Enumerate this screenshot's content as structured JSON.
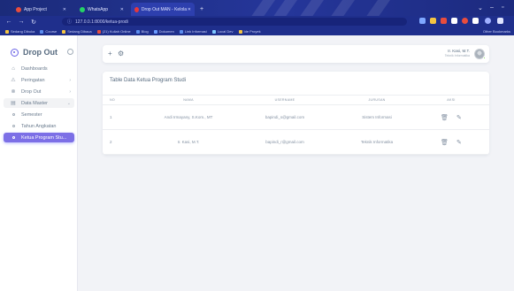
{
  "browser": {
    "tabs": [
      {
        "label": "App Project",
        "fav_color": "#e94d3d"
      },
      {
        "label": "WhatsApp",
        "fav_color": "#25d366"
      },
      {
        "label": "Drop Out MAN - Kelola Prodi",
        "fav_color": "#e6383c"
      }
    ],
    "url": "127.0.0.1:8000/ketua-prodi",
    "bookmarks": [
      {
        "label": "Sedang Dibuka",
        "color": "#f4c542"
      },
      {
        "label": "Course",
        "color": "#5b8def"
      },
      {
        "label": "Sedang Dibaca",
        "color": "#f4c542"
      },
      {
        "label": "(21) Kuliah Online",
        "color": "#e94d3d"
      },
      {
        "label": "Blog",
        "color": "#5b8def"
      },
      {
        "label": "Dokumen",
        "color": "#6a9bff"
      },
      {
        "label": "Link Informasi",
        "color": "#5b8def"
      },
      {
        "label": "Local Dev",
        "color": "#7ec8ff"
      },
      {
        "label": "Ide Proyek",
        "color": "#f4c542"
      }
    ],
    "bookmarks_right": "Other Bookmarks"
  },
  "sidebar": {
    "brand": "Drop Out",
    "items": [
      {
        "label": "Dashboards",
        "icon": "home-icon",
        "glyph": "⌂",
        "chevron": false
      },
      {
        "label": "Peringatan",
        "icon": "warning-icon",
        "glyph": "⚠",
        "chevron": true
      },
      {
        "label": "Drop Out",
        "icon": "dropout-icon",
        "glyph": "⊗",
        "chevron": true
      },
      {
        "label": "Data Master",
        "icon": "database-icon",
        "glyph": "▤",
        "chevron": true
      }
    ],
    "sub_items": [
      {
        "label": "Semester"
      },
      {
        "label": "Tahun Angkatan"
      },
      {
        "label": "Ketua Program Stu..."
      }
    ]
  },
  "topbar": {
    "plus": "+",
    "gear": "⚙",
    "user_name": "Ir. Kasi, M.T.",
    "user_role": "Teknik Informatika"
  },
  "table": {
    "title": "Table Data Ketua Program Studi",
    "headers": [
      "NO",
      "NAMA",
      "USERNAME",
      "JURUSAN",
      "AKSI"
    ],
    "rows": [
      {
        "no": "1",
        "nama": "Andi Irmayany, S.Kom., MT",
        "username": "bapindi_s@gmail.com",
        "jurusan": "Sistem Informasi"
      },
      {
        "no": "2",
        "nama": "Ir. Kasi, M.T.",
        "username": "bapindi_r@gmail.com",
        "jurusan": "Teknik Informatika"
      }
    ],
    "actions": {
      "delete_glyph": "🗑",
      "edit_glyph": "✎"
    }
  }
}
